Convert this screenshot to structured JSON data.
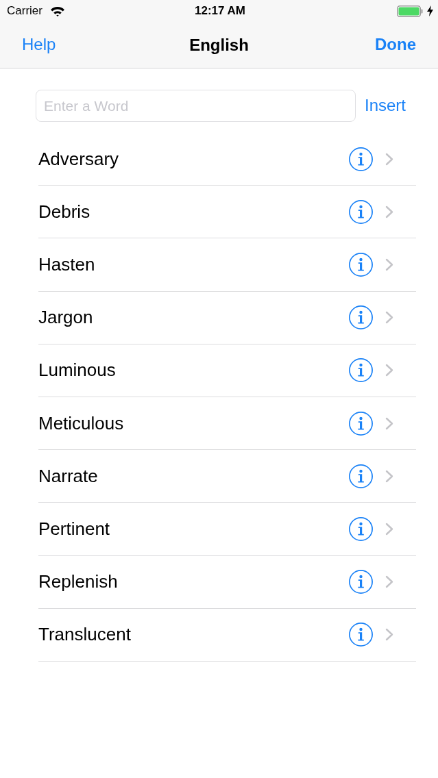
{
  "status_bar": {
    "carrier": "Carrier",
    "time": "12:17 AM",
    "charging": true
  },
  "nav_bar": {
    "left_button": "Help",
    "title": "English",
    "right_button": "Done"
  },
  "entry": {
    "placeholder": "Enter a Word",
    "button": "Insert"
  },
  "words": [
    {
      "text": "Adversary"
    },
    {
      "text": "Debris"
    },
    {
      "text": "Hasten"
    },
    {
      "text": "Jargon"
    },
    {
      "text": "Luminous"
    },
    {
      "text": "Meticulous"
    },
    {
      "text": "Narrate"
    },
    {
      "text": "Pertinent"
    },
    {
      "text": "Replenish"
    },
    {
      "text": "Translucent"
    }
  ]
}
